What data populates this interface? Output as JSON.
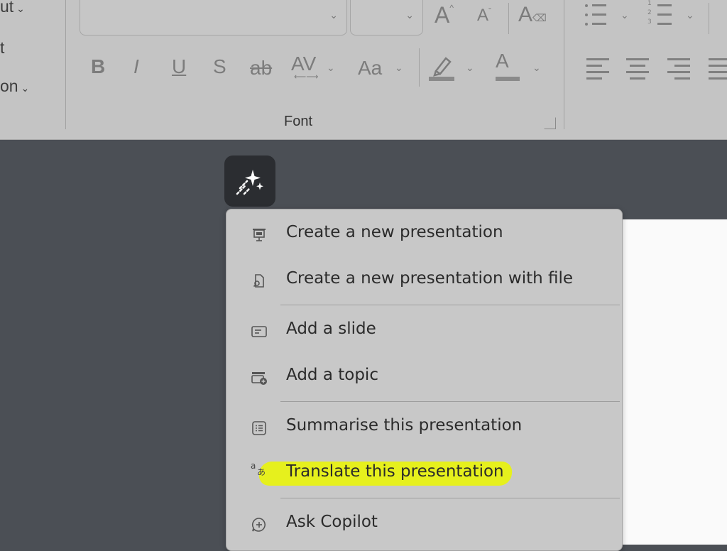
{
  "ribbon": {
    "left_fragments": [
      "ut",
      "t",
      "on"
    ],
    "font_group_label": "Font",
    "format_buttons": [
      "B",
      "I",
      "U",
      "S",
      "ab",
      "AV",
      "Aa"
    ],
    "grow_font": "A",
    "shrink_font": "A",
    "font_color": "A"
  },
  "menu": {
    "items": [
      {
        "label": "Create a new presentation",
        "icon": "presentation-icon"
      },
      {
        "label": "Create a new presentation with file",
        "icon": "file-search-icon"
      },
      {
        "label": "Add a slide",
        "icon": "slide-icon"
      },
      {
        "label": "Add a topic",
        "icon": "topic-add-icon"
      },
      {
        "label": "Summarise this presentation",
        "icon": "summary-icon"
      },
      {
        "label": "Translate this presentation",
        "icon": "translate-icon"
      },
      {
        "label": "Ask Copilot",
        "icon": "chat-add-icon"
      }
    ],
    "highlighted_index": 5
  },
  "colors": {
    "highlight": "#e6f01d",
    "ribbon": "#c4c4c4",
    "workspace": "#4b4f55",
    "copilot_button": "#2b2d31"
  }
}
